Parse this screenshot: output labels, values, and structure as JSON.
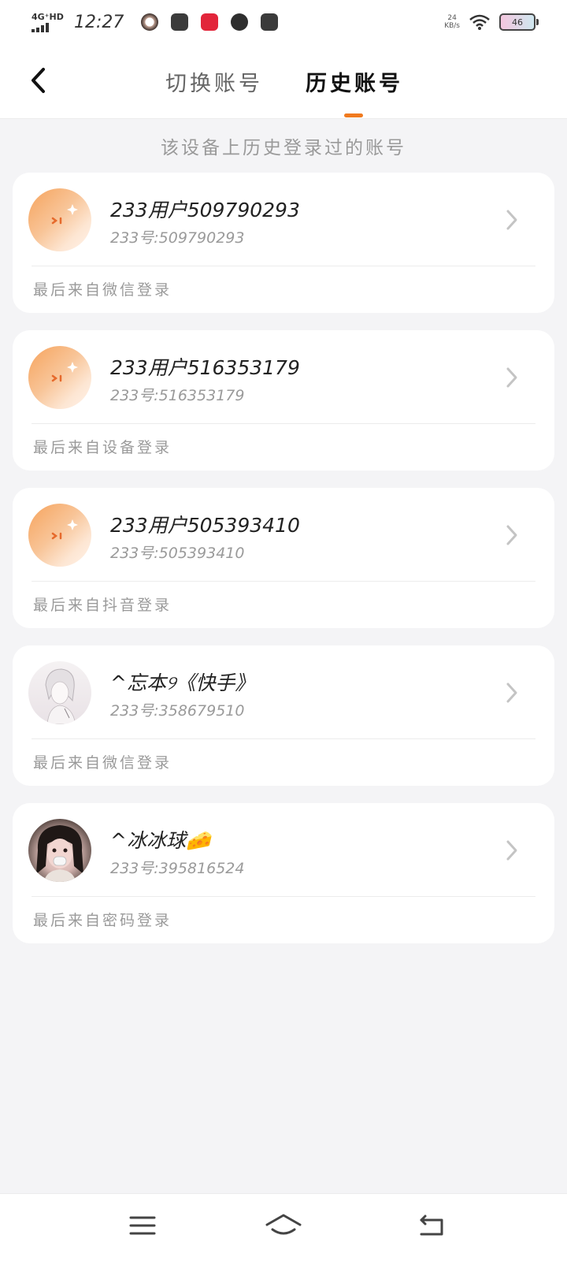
{
  "status_bar": {
    "network": "4G⁺HD",
    "time": "12:27",
    "speed_value": "24",
    "speed_unit": "KB/s",
    "battery": "46",
    "icons": [
      "avatar-notification-icon",
      "mail-app-icon",
      "red-app-icon",
      "link-app-icon",
      "wallet-app-icon",
      "wifi-icon",
      "battery-icon"
    ]
  },
  "header": {
    "back_icon": "chevron-left-icon",
    "tabs": [
      {
        "label": "切换账号",
        "active": false
      },
      {
        "label": "历史账号",
        "active": true
      }
    ],
    "accent_color": "#f07a1e"
  },
  "subtitle": "该设备上历史登录过的账号",
  "accounts": [
    {
      "name": "233用户509790293",
      "uid": "233号:509790293",
      "login_source": "最后来自微信登录",
      "avatar": "default-avatar"
    },
    {
      "name": "233用户516353179",
      "uid": "233号:516353179",
      "login_source": "最后来自设备登录",
      "avatar": "default-avatar"
    },
    {
      "name": "233用户505393410",
      "uid": "233号:505393410",
      "login_source": "最后来自抖音登录",
      "avatar": "default-avatar"
    },
    {
      "name": "^忘本୨《快手》",
      "uid": "233号:358679510",
      "login_source": "最后来自微信登录",
      "avatar": "photo-avatar"
    },
    {
      "name": "^冰冰球🧀",
      "uid": "233号:395816524",
      "login_source": "最后来自密码登录",
      "avatar": "photo-avatar"
    }
  ],
  "nav_bar": {
    "icons": [
      "menu-icon",
      "home-icon",
      "back-icon"
    ]
  }
}
